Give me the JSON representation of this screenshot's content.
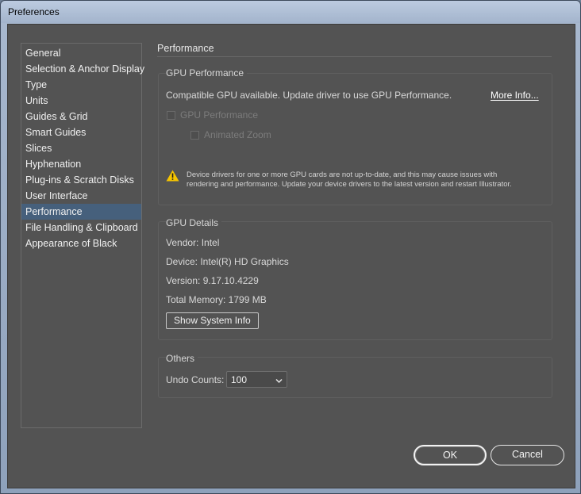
{
  "window": {
    "title": "Preferences"
  },
  "sidebar": {
    "items": [
      {
        "label": "General",
        "selected": false
      },
      {
        "label": "Selection & Anchor Display",
        "selected": false
      },
      {
        "label": "Type",
        "selected": false
      },
      {
        "label": "Units",
        "selected": false
      },
      {
        "label": "Guides & Grid",
        "selected": false
      },
      {
        "label": "Smart Guides",
        "selected": false
      },
      {
        "label": "Slices",
        "selected": false
      },
      {
        "label": "Hyphenation",
        "selected": false
      },
      {
        "label": "Plug-ins & Scratch Disks",
        "selected": false
      },
      {
        "label": "User Interface",
        "selected": false
      },
      {
        "label": "Performance",
        "selected": true
      },
      {
        "label": "File Handling & Clipboard",
        "selected": false
      },
      {
        "label": "Appearance of Black",
        "selected": false
      }
    ]
  },
  "main": {
    "section_title": "Performance",
    "gpu_performance": {
      "title": "GPU Performance",
      "status": "Compatible GPU available. Update driver to use GPU Performance.",
      "more_info": "More Info...",
      "gpu_checkbox_label": "GPU Performance",
      "animated_zoom_label": "Animated Zoom",
      "warning_line1": "Device drivers for one or more GPU cards are not up-to-date, and this may cause issues with",
      "warning_line2": "rendering and performance. Update your device drivers to the latest version and restart Illustrator."
    },
    "gpu_details": {
      "title": "GPU Details",
      "vendor": "Vendor: Intel",
      "device": "Device: Intel(R) HD Graphics",
      "version": "Version: 9.17.10.4229",
      "memory": "Total Memory: 1799 MB",
      "system_info_button": "Show System Info"
    },
    "others": {
      "title": "Others",
      "undo_label": "Undo Counts:",
      "undo_value": "100"
    }
  },
  "footer": {
    "ok": "OK",
    "cancel": "Cancel"
  },
  "colors": {
    "panel": "#535353",
    "selected": "#46607c",
    "warning": "#f5c400"
  },
  "icons": {
    "warning": "warning-triangle-icon",
    "dropdown": "chevron-down-icon"
  }
}
